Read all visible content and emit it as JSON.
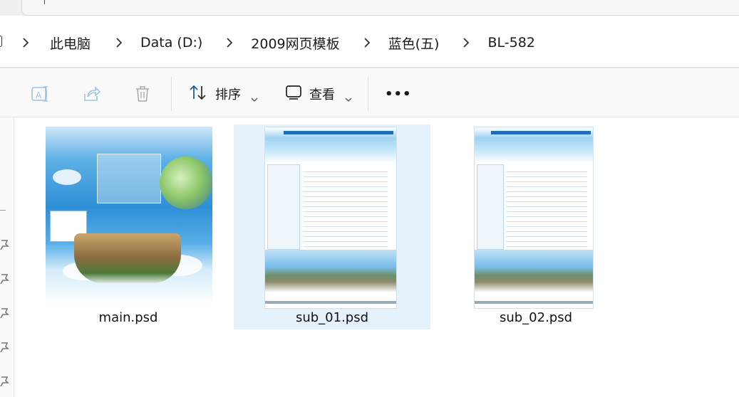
{
  "breadcrumb": {
    "items": [
      "此电脑",
      "Data (D:)",
      "2009网页模板",
      "蓝色(五)",
      "BL-582"
    ]
  },
  "toolbar": {
    "sort_label": "排序",
    "view_label": "查看",
    "more_label": "•••"
  },
  "files": [
    {
      "name": "main.psd",
      "selected": false
    },
    {
      "name": "sub_01.psd",
      "selected": true
    },
    {
      "name": "sub_02.psd",
      "selected": false
    }
  ],
  "colors": {
    "accent_selected": "#e5f1fb",
    "icon_disabled": "#9cc3e2",
    "text": "#1a1a1a"
  }
}
